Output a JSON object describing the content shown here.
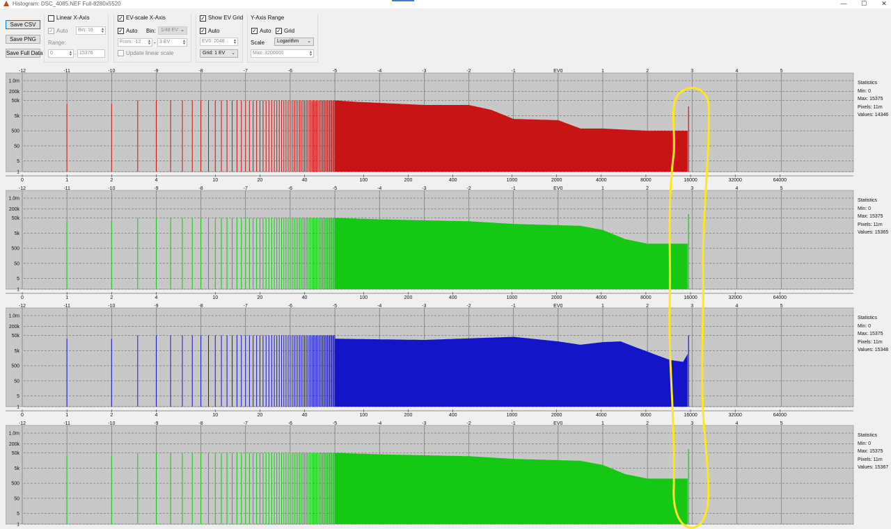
{
  "window": {
    "title": "Histogram: DSC_4085.NEF Full-8280x5520",
    "controls": [
      "—",
      "☐",
      "✕"
    ]
  },
  "buttons": {
    "save_csv": "Save CSV",
    "save_png": "Save PNG",
    "save_full_data": "Save Full Data"
  },
  "linear_x": {
    "label": "Linear X-Axis",
    "checked": false,
    "auto_label": "Auto",
    "bin_value": "Bin: 16",
    "range_label": "Range:",
    "range_from": "0",
    "range_to": "15376"
  },
  "ev_x": {
    "label": "EV-scale X-Axis",
    "checked": true,
    "auto_label": "Auto",
    "bin_label": "Bin:",
    "bin_value": "1/48 EV",
    "from_value": "From: -12",
    "dash": "-",
    "to_value": "3 EV",
    "update_label": "Update linear scale"
  },
  "ev_grid": {
    "label": "Show EV Grid",
    "checked": true,
    "auto_label": "Auto",
    "ev0_value": "EV0: 2048",
    "grid_value": "Grid: 1 EV"
  },
  "y_axis": {
    "label": "Y-Axis Range",
    "auto_label": "Auto",
    "grid_label": "Grid",
    "scale_label": "Scale",
    "scale_value": "Logarithm",
    "max_value": "Max: 3200000"
  },
  "axes": {
    "ev_ticks": [
      "-12",
      "-11",
      "-10",
      "-9",
      "-8",
      "-7",
      "-6",
      "-5",
      "-4",
      "-3",
      "-2",
      "-1",
      "EV0",
      "1",
      "2",
      "3",
      "4",
      "5"
    ],
    "linear_ticks": [
      "0",
      "1",
      "2",
      "4",
      "10",
      "20",
      "40",
      "100",
      "200",
      "400",
      "1000",
      "2000",
      "4000",
      "8000",
      "16000",
      "32000",
      "64000"
    ],
    "y_ticks": [
      "1.0m",
      "200k",
      "50k",
      "5k",
      "500",
      "50",
      "5",
      "1"
    ]
  },
  "colors": {
    "red": "#c81414",
    "green": "#14c814",
    "blue": "#1414c8",
    "plot_bg": "#c8c8c8",
    "highlight": "#ffe61e"
  },
  "channels": [
    {
      "name": "red",
      "stats": {
        "title": "Statistics",
        "min": "Min: 0",
        "max": "Max: 15375",
        "pixels": "Pixels: 11m",
        "values": "Values: 14346"
      }
    },
    {
      "name": "green",
      "stats": {
        "title": "Statistics",
        "min": "Min: 0",
        "max": "Max: 15375",
        "pixels": "Pixels: 11m",
        "values": "Values: 15365"
      }
    },
    {
      "name": "blue",
      "stats": {
        "title": "Statistics",
        "min": "Min: 0",
        "max": "Max: 15375",
        "pixels": "Pixels: 11m",
        "values": "Values: 15348"
      }
    },
    {
      "name": "green",
      "stats": {
        "title": "Statistics",
        "min": "Min: 0",
        "max": "Max: 15375",
        "pixels": "Pixels: 11m",
        "values": "Values: 15367"
      }
    }
  ],
  "chart_data": [
    {
      "type": "area",
      "series": "red",
      "x_scale": "ev",
      "xlim": [
        -12,
        5
      ],
      "ylim": [
        1,
        3200000
      ],
      "y_scale": "log",
      "grid": true,
      "envelope": [
        [
          -5,
          50000
        ],
        [
          -4.5,
          40000
        ],
        [
          -3,
          25000
        ],
        [
          -2,
          25000
        ],
        [
          -1.5,
          12000
        ],
        [
          -1,
          3000
        ],
        [
          0,
          2500
        ],
        [
          0.5,
          700
        ],
        [
          1,
          700
        ],
        [
          2,
          500
        ],
        [
          2.9,
          500
        ]
      ],
      "spikes_below_ev": -5,
      "spike_height": 50000,
      "end_spike": [
        2.92,
        20000
      ]
    },
    {
      "type": "area",
      "series": "green",
      "x_scale": "ev",
      "xlim": [
        -12,
        5
      ],
      "ylim": [
        1,
        3200000
      ],
      "y_scale": "log",
      "grid": true,
      "envelope": [
        [
          -5,
          50000
        ],
        [
          -4,
          40000
        ],
        [
          -2,
          30000
        ],
        [
          -1,
          20000
        ],
        [
          0.5,
          15000
        ],
        [
          1,
          8000
        ],
        [
          1.5,
          2000
        ],
        [
          2,
          1000
        ],
        [
          2.9,
          1000
        ]
      ],
      "spikes_below_ev": -5,
      "spike_height": 50000,
      "end_spike": [
        2.92,
        90000
      ]
    },
    {
      "type": "area",
      "series": "blue",
      "x_scale": "ev",
      "xlim": [
        -12,
        5
      ],
      "ylim": [
        1,
        3200000
      ],
      "y_scale": "log",
      "grid": true,
      "envelope": [
        [
          -5,
          30000
        ],
        [
          -3,
          25000
        ],
        [
          -1,
          40000
        ],
        [
          0,
          20000
        ],
        [
          0.5,
          12000
        ],
        [
          1,
          18000
        ],
        [
          1.4,
          20000
        ],
        [
          1.8,
          7000
        ],
        [
          2.5,
          1200
        ],
        [
          2.8,
          900
        ],
        [
          2.9,
          3000
        ]
      ],
      "spikes_below_ev": -5,
      "spike_height": 50000,
      "end_spike": [
        2.92,
        50000
      ]
    },
    {
      "type": "area",
      "series": "green",
      "x_scale": "ev",
      "xlim": [
        -12,
        5
      ],
      "ylim": [
        1,
        3200000
      ],
      "y_scale": "log",
      "grid": true,
      "envelope": [
        [
          -5,
          50000
        ],
        [
          -4,
          40000
        ],
        [
          -2,
          30000
        ],
        [
          -1,
          20000
        ],
        [
          0.5,
          15000
        ],
        [
          1,
          8000
        ],
        [
          1.5,
          2000
        ],
        [
          2,
          1000
        ],
        [
          2.9,
          1000
        ]
      ],
      "spikes_below_ev": -5,
      "spike_height": 50000,
      "end_spike": [
        2.92,
        90000
      ]
    }
  ]
}
